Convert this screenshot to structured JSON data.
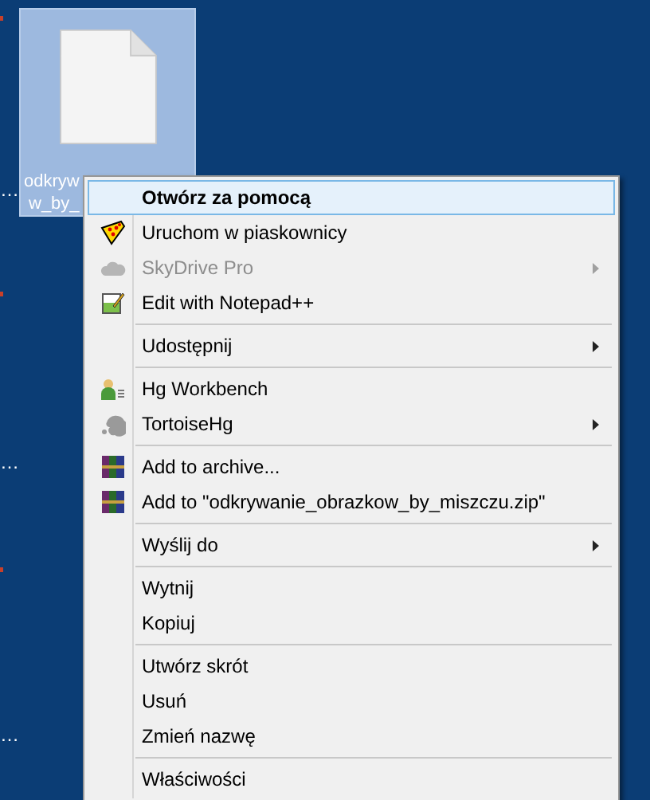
{
  "desktop": {
    "edge_labels": [
      "…",
      "…",
      "…"
    ],
    "file": {
      "label_lines": [
        "odkryw",
        "w_by_"
      ],
      "selected": true
    }
  },
  "context_menu": {
    "items": [
      {
        "kind": "item",
        "label": "Otwórz za pomocą",
        "bold": true,
        "selected": true,
        "disabled": false,
        "submenu": false
      },
      {
        "kind": "item",
        "label": "Uruchom w piaskownicy",
        "bold": false,
        "selected": false,
        "disabled": false,
        "submenu": false
      },
      {
        "kind": "item",
        "label": "SkyDrive Pro",
        "bold": false,
        "selected": false,
        "disabled": true,
        "submenu": true
      },
      {
        "kind": "item",
        "label": "Edit with Notepad++",
        "bold": false,
        "selected": false,
        "disabled": false,
        "submenu": false
      },
      {
        "kind": "separator"
      },
      {
        "kind": "item",
        "label": "Udostępnij",
        "bold": false,
        "selected": false,
        "disabled": false,
        "submenu": true
      },
      {
        "kind": "separator"
      },
      {
        "kind": "item",
        "label": "Hg Workbench",
        "bold": false,
        "selected": false,
        "disabled": false,
        "submenu": false
      },
      {
        "kind": "item",
        "label": "TortoiseHg",
        "bold": false,
        "selected": false,
        "disabled": false,
        "submenu": true
      },
      {
        "kind": "separator"
      },
      {
        "kind": "item",
        "label": "Add to archive...",
        "bold": false,
        "selected": false,
        "disabled": false,
        "submenu": false
      },
      {
        "kind": "item",
        "label": "Add to \"odkrywanie_obrazkow_by_miszczu.zip\"",
        "bold": false,
        "selected": false,
        "disabled": false,
        "submenu": false
      },
      {
        "kind": "separator"
      },
      {
        "kind": "item",
        "label": "Wyślij do",
        "bold": false,
        "selected": false,
        "disabled": false,
        "submenu": true
      },
      {
        "kind": "separator"
      },
      {
        "kind": "item",
        "label": "Wytnij",
        "bold": false,
        "selected": false,
        "disabled": false,
        "submenu": false
      },
      {
        "kind": "item",
        "label": "Kopiuj",
        "bold": false,
        "selected": false,
        "disabled": false,
        "submenu": false
      },
      {
        "kind": "separator"
      },
      {
        "kind": "item",
        "label": "Utwórz skrót",
        "bold": false,
        "selected": false,
        "disabled": false,
        "submenu": false
      },
      {
        "kind": "item",
        "label": "Usuń",
        "bold": false,
        "selected": false,
        "disabled": false,
        "submenu": false
      },
      {
        "kind": "item",
        "label": "Zmień nazwę",
        "bold": false,
        "selected": false,
        "disabled": false,
        "submenu": false
      },
      {
        "kind": "separator"
      },
      {
        "kind": "item",
        "label": "Właściwości",
        "bold": false,
        "selected": false,
        "disabled": false,
        "submenu": false
      }
    ]
  }
}
